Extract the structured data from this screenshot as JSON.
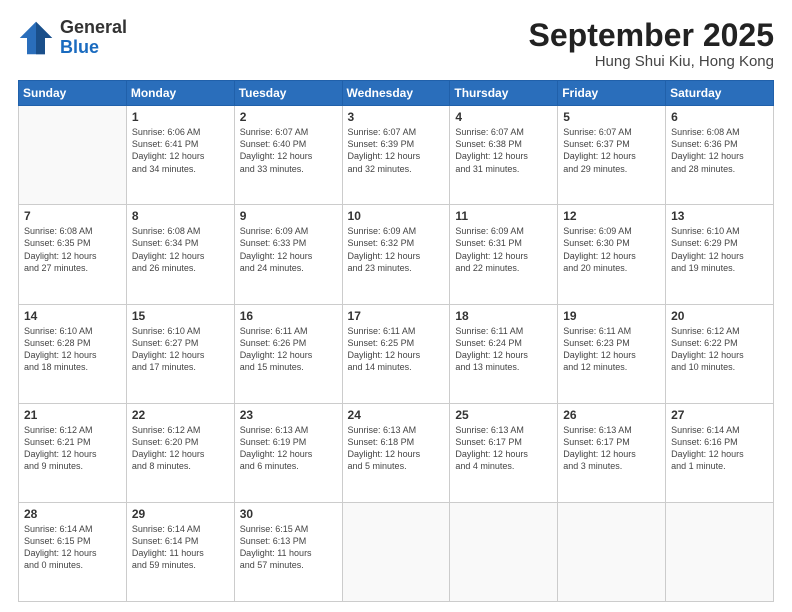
{
  "header": {
    "logo_general": "General",
    "logo_blue": "Blue",
    "month_title": "September 2025",
    "location": "Hung Shui Kiu, Hong Kong"
  },
  "weekdays": [
    "Sunday",
    "Monday",
    "Tuesday",
    "Wednesday",
    "Thursday",
    "Friday",
    "Saturday"
  ],
  "weeks": [
    [
      {
        "day": "",
        "info": ""
      },
      {
        "day": "1",
        "info": "Sunrise: 6:06 AM\nSunset: 6:41 PM\nDaylight: 12 hours\nand 34 minutes."
      },
      {
        "day": "2",
        "info": "Sunrise: 6:07 AM\nSunset: 6:40 PM\nDaylight: 12 hours\nand 33 minutes."
      },
      {
        "day": "3",
        "info": "Sunrise: 6:07 AM\nSunset: 6:39 PM\nDaylight: 12 hours\nand 32 minutes."
      },
      {
        "day": "4",
        "info": "Sunrise: 6:07 AM\nSunset: 6:38 PM\nDaylight: 12 hours\nand 31 minutes."
      },
      {
        "day": "5",
        "info": "Sunrise: 6:07 AM\nSunset: 6:37 PM\nDaylight: 12 hours\nand 29 minutes."
      },
      {
        "day": "6",
        "info": "Sunrise: 6:08 AM\nSunset: 6:36 PM\nDaylight: 12 hours\nand 28 minutes."
      }
    ],
    [
      {
        "day": "7",
        "info": "Sunrise: 6:08 AM\nSunset: 6:35 PM\nDaylight: 12 hours\nand 27 minutes."
      },
      {
        "day": "8",
        "info": "Sunrise: 6:08 AM\nSunset: 6:34 PM\nDaylight: 12 hours\nand 26 minutes."
      },
      {
        "day": "9",
        "info": "Sunrise: 6:09 AM\nSunset: 6:33 PM\nDaylight: 12 hours\nand 24 minutes."
      },
      {
        "day": "10",
        "info": "Sunrise: 6:09 AM\nSunset: 6:32 PM\nDaylight: 12 hours\nand 23 minutes."
      },
      {
        "day": "11",
        "info": "Sunrise: 6:09 AM\nSunset: 6:31 PM\nDaylight: 12 hours\nand 22 minutes."
      },
      {
        "day": "12",
        "info": "Sunrise: 6:09 AM\nSunset: 6:30 PM\nDaylight: 12 hours\nand 20 minutes."
      },
      {
        "day": "13",
        "info": "Sunrise: 6:10 AM\nSunset: 6:29 PM\nDaylight: 12 hours\nand 19 minutes."
      }
    ],
    [
      {
        "day": "14",
        "info": "Sunrise: 6:10 AM\nSunset: 6:28 PM\nDaylight: 12 hours\nand 18 minutes."
      },
      {
        "day": "15",
        "info": "Sunrise: 6:10 AM\nSunset: 6:27 PM\nDaylight: 12 hours\nand 17 minutes."
      },
      {
        "day": "16",
        "info": "Sunrise: 6:11 AM\nSunset: 6:26 PM\nDaylight: 12 hours\nand 15 minutes."
      },
      {
        "day": "17",
        "info": "Sunrise: 6:11 AM\nSunset: 6:25 PM\nDaylight: 12 hours\nand 14 minutes."
      },
      {
        "day": "18",
        "info": "Sunrise: 6:11 AM\nSunset: 6:24 PM\nDaylight: 12 hours\nand 13 minutes."
      },
      {
        "day": "19",
        "info": "Sunrise: 6:11 AM\nSunset: 6:23 PM\nDaylight: 12 hours\nand 12 minutes."
      },
      {
        "day": "20",
        "info": "Sunrise: 6:12 AM\nSunset: 6:22 PM\nDaylight: 12 hours\nand 10 minutes."
      }
    ],
    [
      {
        "day": "21",
        "info": "Sunrise: 6:12 AM\nSunset: 6:21 PM\nDaylight: 12 hours\nand 9 minutes."
      },
      {
        "day": "22",
        "info": "Sunrise: 6:12 AM\nSunset: 6:20 PM\nDaylight: 12 hours\nand 8 minutes."
      },
      {
        "day": "23",
        "info": "Sunrise: 6:13 AM\nSunset: 6:19 PM\nDaylight: 12 hours\nand 6 minutes."
      },
      {
        "day": "24",
        "info": "Sunrise: 6:13 AM\nSunset: 6:18 PM\nDaylight: 12 hours\nand 5 minutes."
      },
      {
        "day": "25",
        "info": "Sunrise: 6:13 AM\nSunset: 6:17 PM\nDaylight: 12 hours\nand 4 minutes."
      },
      {
        "day": "26",
        "info": "Sunrise: 6:13 AM\nSunset: 6:17 PM\nDaylight: 12 hours\nand 3 minutes."
      },
      {
        "day": "27",
        "info": "Sunrise: 6:14 AM\nSunset: 6:16 PM\nDaylight: 12 hours\nand 1 minute."
      }
    ],
    [
      {
        "day": "28",
        "info": "Sunrise: 6:14 AM\nSunset: 6:15 PM\nDaylight: 12 hours\nand 0 minutes."
      },
      {
        "day": "29",
        "info": "Sunrise: 6:14 AM\nSunset: 6:14 PM\nDaylight: 11 hours\nand 59 minutes."
      },
      {
        "day": "30",
        "info": "Sunrise: 6:15 AM\nSunset: 6:13 PM\nDaylight: 11 hours\nand 57 minutes."
      },
      {
        "day": "",
        "info": ""
      },
      {
        "day": "",
        "info": ""
      },
      {
        "day": "",
        "info": ""
      },
      {
        "day": "",
        "info": ""
      }
    ]
  ]
}
